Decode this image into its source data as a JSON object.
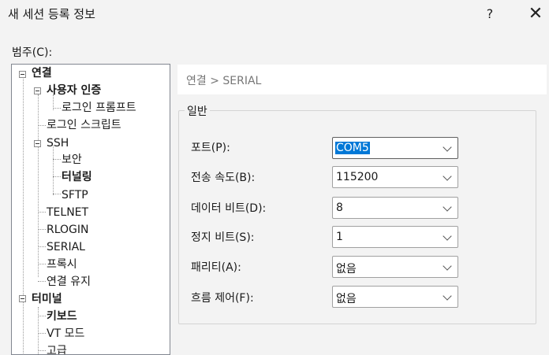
{
  "window": {
    "title": "새 세션 등록 정보",
    "help_label": "?",
    "close_label": "✕"
  },
  "category_label": "범주(C):",
  "tree": {
    "items": [
      {
        "label": "연결",
        "bold": true
      },
      {
        "label": "사용자 인증",
        "bold": true
      },
      {
        "label": "로그인 프롬프트",
        "bold": false
      },
      {
        "label": "로그인 스크립트",
        "bold": false
      },
      {
        "label": "SSH",
        "bold": false
      },
      {
        "label": "보안",
        "bold": false
      },
      {
        "label": "터널링",
        "bold": true
      },
      {
        "label": "SFTP",
        "bold": false
      },
      {
        "label": "TELNET",
        "bold": false
      },
      {
        "label": "RLOGIN",
        "bold": false
      },
      {
        "label": "SERIAL",
        "bold": false
      },
      {
        "label": "프록시",
        "bold": false
      },
      {
        "label": "연결 유지",
        "bold": false
      },
      {
        "label": "터미널",
        "bold": true
      },
      {
        "label": "키보드",
        "bold": true
      },
      {
        "label": "VT 모드",
        "bold": false
      },
      {
        "label": "고급",
        "bold": false
      }
    ],
    "selected": "SERIAL"
  },
  "breadcrumb": "연결 > SERIAL",
  "group_title": "일반",
  "fields": [
    {
      "label": "포트(P):",
      "value": "COM5",
      "selected": true
    },
    {
      "label": "전송 속도(B):",
      "value": "115200",
      "selected": false
    },
    {
      "label": "데이터 비트(D):",
      "value": "8",
      "selected": false
    },
    {
      "label": "정지 비트(S):",
      "value": "1",
      "selected": false
    },
    {
      "label": "패리티(A):",
      "value": "없음",
      "selected": false
    },
    {
      "label": "흐름 제어(F):",
      "value": "없음",
      "selected": false
    }
  ]
}
